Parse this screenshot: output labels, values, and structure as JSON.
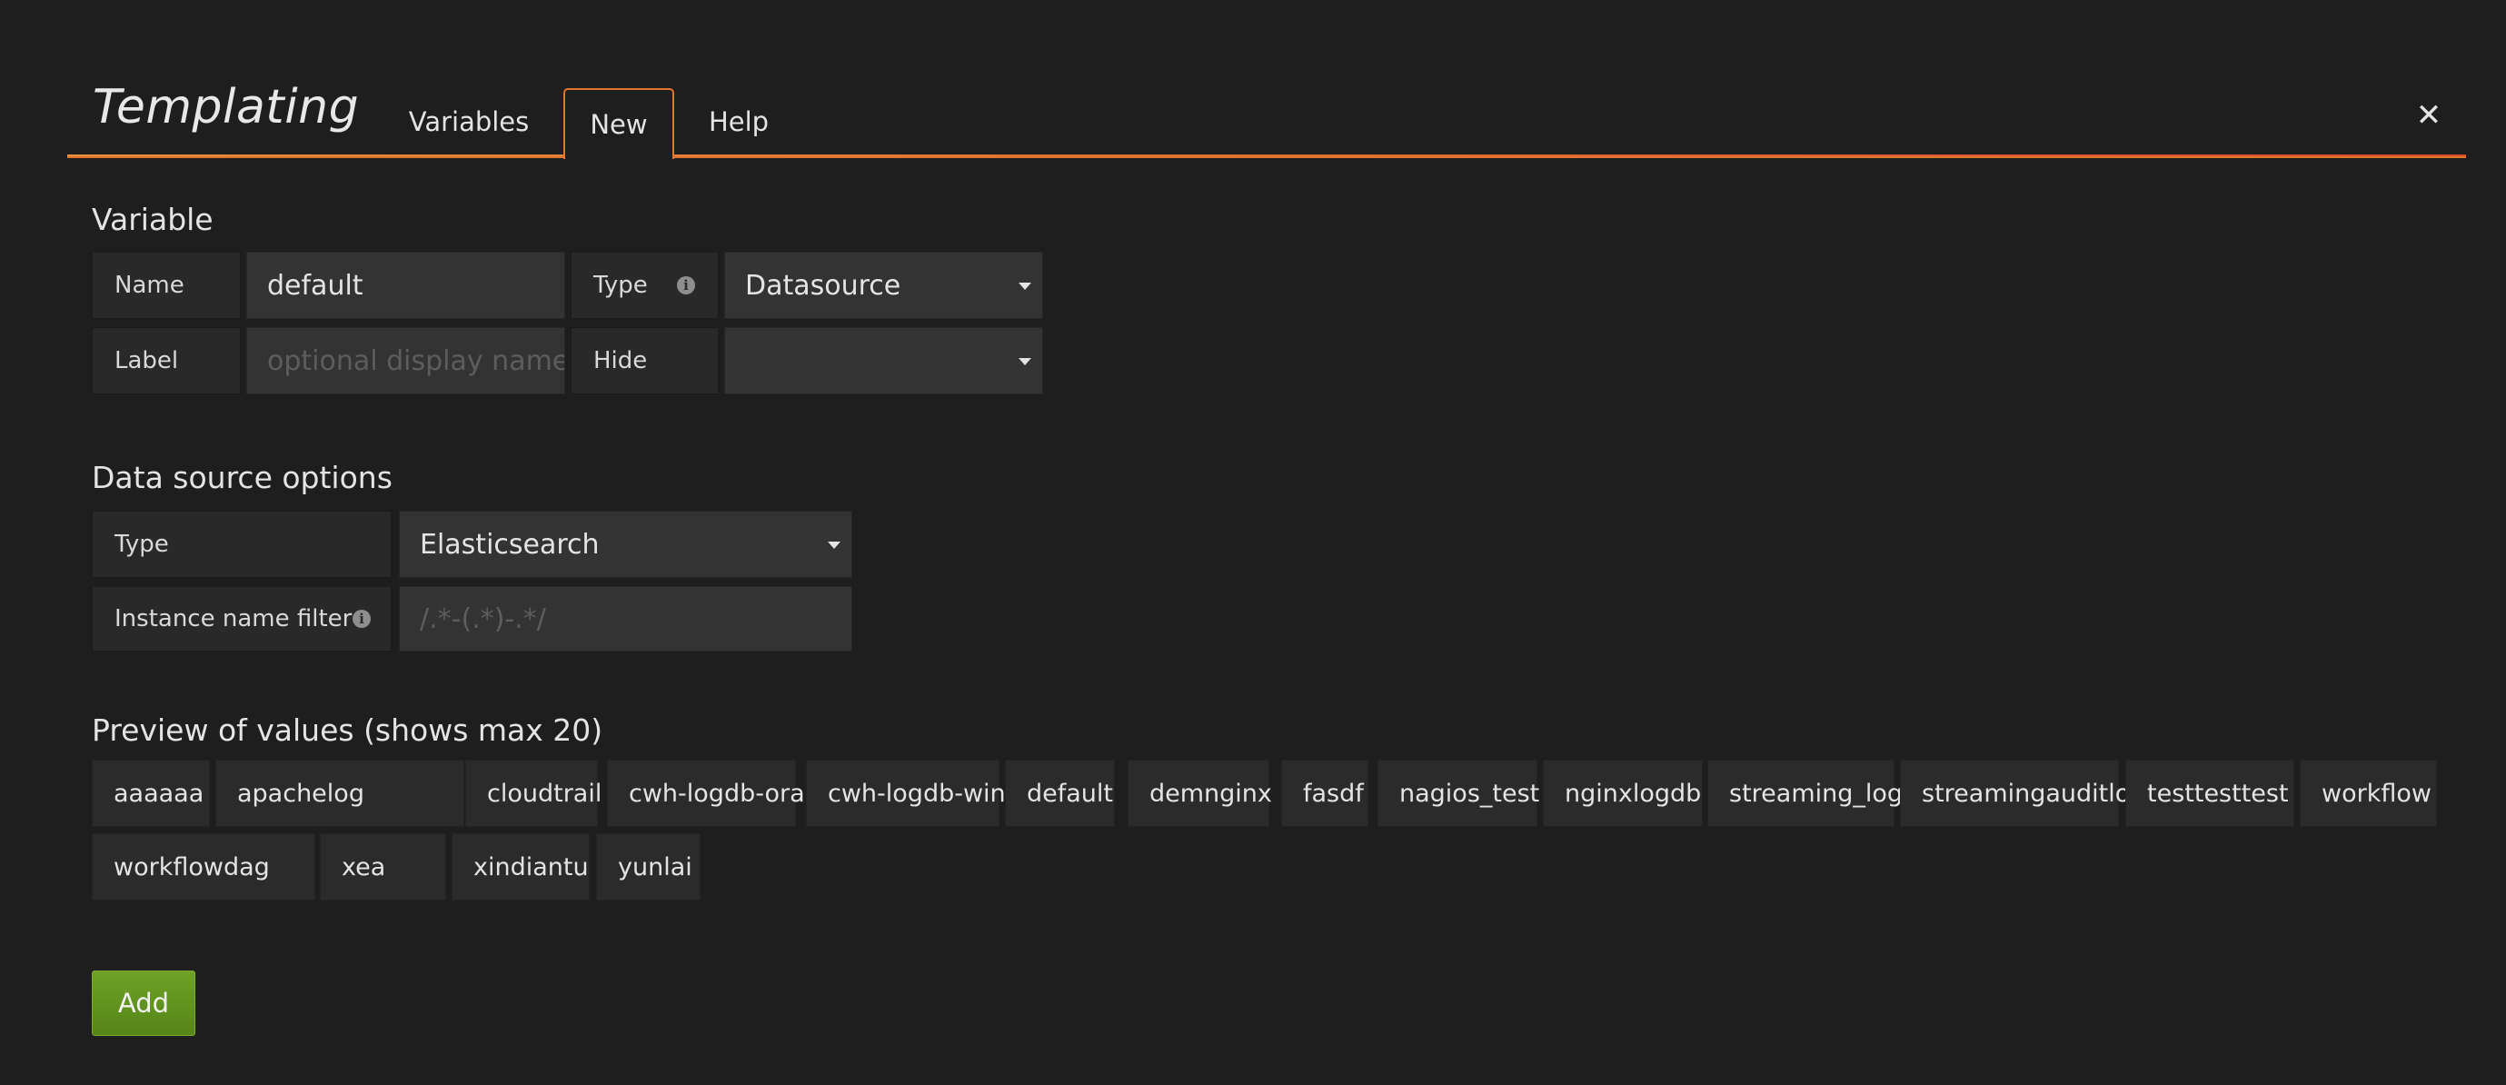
{
  "header": {
    "title": "Templating",
    "tabs": [
      {
        "label": "Variables",
        "active": false
      },
      {
        "label": "New",
        "active": true
      },
      {
        "label": "Help",
        "active": false
      }
    ],
    "close_icon": "close-icon",
    "accent_color": "#e0752d"
  },
  "variable": {
    "section_title": "Variable",
    "name_label": "Name",
    "name_value": "default",
    "type_label": "Type",
    "type_value": "Datasource",
    "label_label": "Label",
    "label_placeholder": "optional display name",
    "hide_label": "Hide",
    "hide_value": ""
  },
  "datasource_options": {
    "section_title": "Data source options",
    "type_label": "Type",
    "type_value": "Elasticsearch",
    "filter_label": "Instance name filter",
    "filter_placeholder": "/.*-(.*)-.*/"
  },
  "preview": {
    "section_title": "Preview of values (shows max 20)",
    "values": [
      "aaaaaa",
      "apachelog",
      "cloudtrail",
      "cwh-logdb-ora",
      "cwh-logdb-win",
      "default",
      "demnginx",
      "fasdf",
      "nagios_test",
      "nginxlogdb",
      "streaming_log",
      "streamingauditlog",
      "testtesttest",
      "workflow",
      "workflowdag",
      "xea",
      "xindiantu",
      "yunlai"
    ]
  },
  "actions": {
    "add_label": "Add",
    "add_color": "#629624"
  }
}
